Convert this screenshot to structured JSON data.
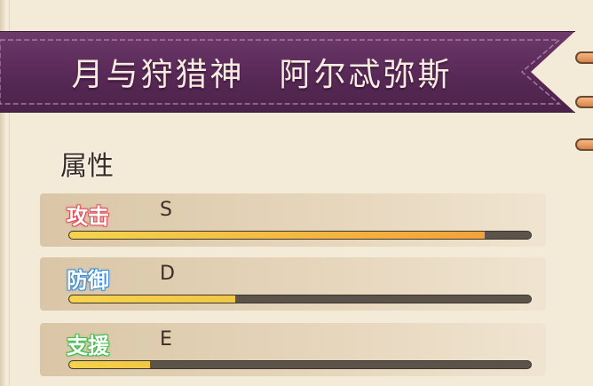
{
  "banner": {
    "title": "月与狩猎神　阿尔忒弥斯",
    "color": "#5e2d5c"
  },
  "attributes": {
    "heading": "属性",
    "stats": [
      {
        "label": "攻击",
        "grade": "S",
        "level": 0.9,
        "label_color": "#e0505a"
      },
      {
        "label": "防御",
        "grade": "D",
        "level": 0.36,
        "label_color": "#3a8ed8"
      },
      {
        "label": "支援",
        "grade": "E",
        "level": 0.175,
        "label_color": "#3dbb4a"
      }
    ]
  }
}
